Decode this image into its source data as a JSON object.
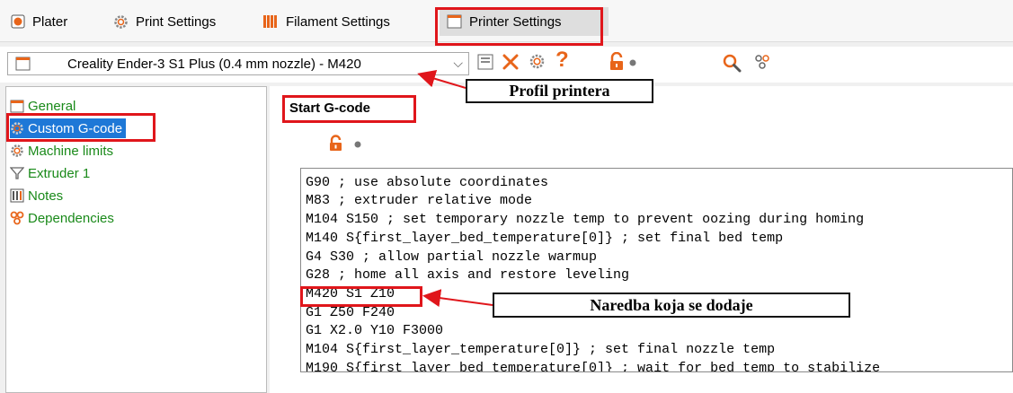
{
  "tabs": [
    {
      "label": "Plater",
      "icon": "plater-icon"
    },
    {
      "label": "Print Settings",
      "icon": "print-settings-gear-icon"
    },
    {
      "label": "Filament Settings",
      "icon": "filament-icon"
    },
    {
      "label": "Printer Settings",
      "icon": "printer-icon",
      "active": true
    }
  ],
  "toolbar": {
    "preset": "Creality Ender-3 S1 Plus (0.4 mm nozzle) - M420",
    "dropdown_arrow": "⌵",
    "help": "?",
    "icons": [
      "save-icon",
      "delete-icon",
      "compare-icon",
      "help-icon",
      "lock-icon",
      "dot-icon",
      "search-icon",
      "settings-icon"
    ]
  },
  "sidebar": {
    "items": [
      {
        "label": "General",
        "icon": "printer-icon"
      },
      {
        "label": "Custom G-code",
        "icon": "gear-icon",
        "selected": true
      },
      {
        "label": "Machine limits",
        "icon": "gear-icon"
      },
      {
        "label": "Extruder 1",
        "icon": "funnel-icon"
      },
      {
        "label": "Notes",
        "icon": "notes-icon"
      },
      {
        "label": "Dependencies",
        "icon": "dependencies-icon"
      }
    ]
  },
  "main": {
    "section_title": "Start G-code",
    "code_lines": [
      "G90 ; use absolute coordinates",
      "M83 ; extruder relative mode",
      "M104 S150 ; set temporary nozzle temp to prevent oozing during homing",
      "M140 S{first_layer_bed_temperature[0]} ; set final bed temp",
      "G4 S30 ; allow partial nozzle warmup",
      "G28 ; home all axis and restore leveling",
      "M420 S1 Z10",
      "G1 Z50 F240",
      "G1 X2.0 Y10 F3000",
      "M104 S{first_layer_temperature[0]} ; set final nozzle temp",
      "M190 S{first_layer_bed_temperature[0]} ; wait for bed temp to stabilize"
    ]
  },
  "annotations": {
    "profile_callout": "Profil printera",
    "command_callout": "Naredba koja se dodaje"
  },
  "colors": {
    "highlight_red": "#e0161b",
    "lock_orange": "#e8651a",
    "tree_green": "#1a8a1a",
    "selection_blue": "#1e78d7"
  }
}
